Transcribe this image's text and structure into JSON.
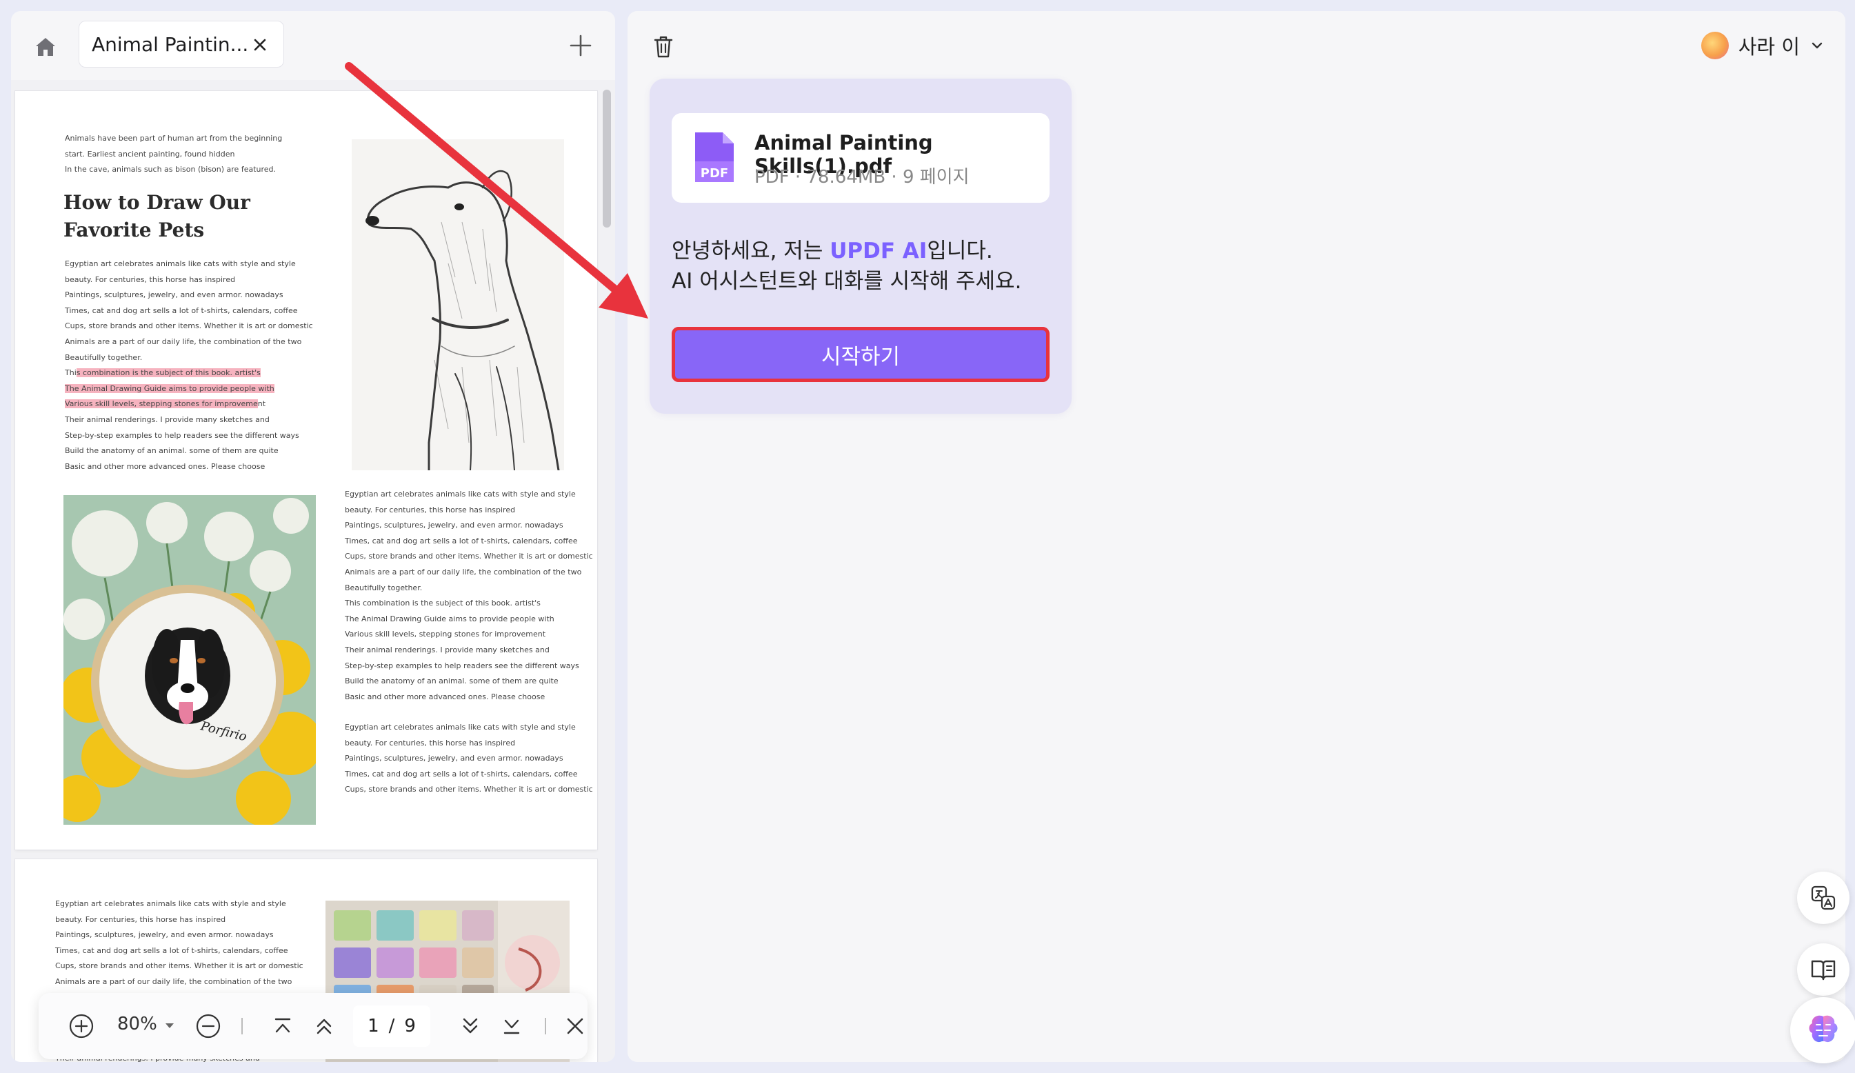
{
  "tab": {
    "title": "Animal Paintin..."
  },
  "document": {
    "page1": {
      "intro_lines": "Animals have been part of human art from the beginning\nstart. Earliest ancient painting, found hidden\nIn the cave, animals such as bison (bison) are featured.",
      "title_line1": "How to Draw Our",
      "title_line2": "Favorite Pets",
      "body_a": "Egyptian art celebrates animals like cats with style and style\nbeauty. For centuries, this horse has inspired\nPaintings, sculptures, jewelry, and even armor. nowadays\nTimes, cat and dog art sells a lot of t-shirts, calendars, coffee\nCups, store brands and other items. Whether it is art or domestic\nAnimals are a part of our daily life, the combination of the two\nBeautifully together.",
      "hl_pre": "Thi",
      "hl_1": "s combination is the subject of this book. artist's",
      "hl_2": "The Animal Drawing Guide aims to provide people with",
      "hl_3": "Various skill levels, stepping stones for improveme",
      "hl_post": "nt",
      "body_b": "Their animal renderings. I provide many sketches and\nStep-by-step examples to help readers see the different ways\nBuild the anatomy of an animal. some of them are quite\nBasic and other more advanced ones. Please choose",
      "col2_a": "Egyptian art celebrates animals like cats with style and style\nbeauty. For centuries, this horse has inspired\nPaintings, sculptures, jewelry, and even armor. nowadays\nTimes, cat and dog art sells a lot of t-shirts, calendars, coffee\nCups, store brands and other items. Whether it is art or domestic\nAnimals are a part of our daily life, the combination of the two\nBeautifully together.\nThis combination is the subject of this book. artist's\nThe Animal Drawing Guide aims to provide people with\nVarious skill levels, stepping stones for improvement\nTheir animal renderings. I provide many sketches and\nStep-by-step examples to help readers see the different ways\nBuild the anatomy of an animal. some of them are quite\nBasic and other more advanced ones. Please choose",
      "col2_b": "Egyptian art celebrates animals like cats with style and style\nbeauty. For centuries, this horse has inspired\nPaintings, sculptures, jewelry, and even armor. nowadays\nTimes, cat and dog art sells a lot of t-shirts, calendars, coffee\nCups, store brands and other items. Whether it is art or domestic",
      "embroidery_signature": "Porfirio"
    },
    "page2": {
      "body": "Egyptian art celebrates animals like cats with style and style\nbeauty. For centuries, this horse has inspired\nPaintings, sculptures, jewelry, and even armor. nowadays\nTimes, cat and dog art sells a lot of t-shirts, calendars, coffee\nCups, store brands and other items. Whether it is art or domestic\nAnimals are a part of our daily life, the combination of the two\nBeautifully together.",
      "bottom": "Their animal renderings. I provide many sketches and"
    }
  },
  "toolbar": {
    "zoom": "80%",
    "current_page": "1",
    "separator": "/",
    "total_pages": "9"
  },
  "user": {
    "name": "사라 이"
  },
  "file": {
    "name": "Animal Painting Skills(1).pdf",
    "meta": "PDF · 78.64MB · 9 페이지",
    "icon_label": "PDF"
  },
  "chat": {
    "greet_pre": "안녕하세요, 저는 ",
    "brand": "UPDF AI",
    "greet_post": "입니다.",
    "greet_line2": "AI 어시스턴트와 대화를 시작해 주세요.",
    "start_button": "시작하기"
  },
  "colors": {
    "accent": "#8866f7",
    "brand_text": "#7b61ff",
    "highlight": "#f6b3bf",
    "annotation_arrow": "#e8333d"
  },
  "icons": [
    "home-icon",
    "close-icon",
    "plus-icon",
    "trash-icon",
    "zoom-in-icon",
    "zoom-out-icon",
    "first-page-icon",
    "prev-page-icon",
    "next-page-icon",
    "last-page-icon",
    "close-toolbar-icon",
    "translate-icon",
    "book-icon",
    "ai-brain-icon",
    "pdf-file-icon"
  ]
}
